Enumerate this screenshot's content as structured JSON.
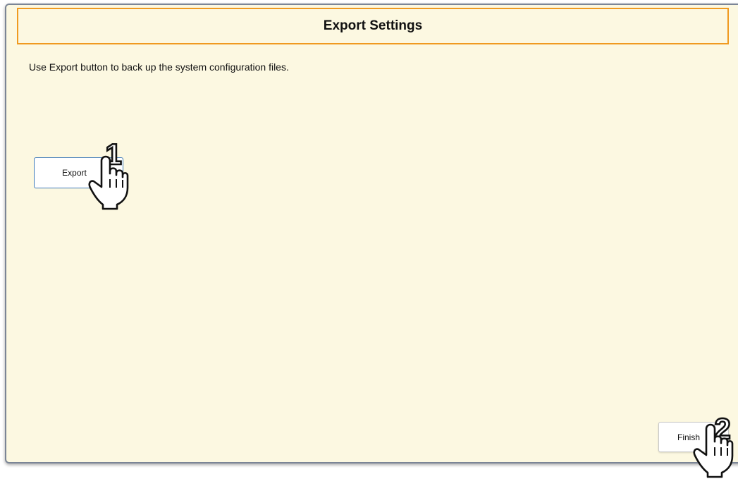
{
  "dialog": {
    "title": "Export Settings",
    "description": "Use Export button to back up the system configuration files."
  },
  "buttons": {
    "export_label": "Export",
    "finish_label": "Finish"
  },
  "callouts": {
    "step1_number": "1",
    "step2_number": "2",
    "pointer_icon": "hand-pointer-icon"
  },
  "colors": {
    "panel_background": "#fcf8e1",
    "header_border": "#f09a20",
    "export_border": "#3d79b8"
  }
}
